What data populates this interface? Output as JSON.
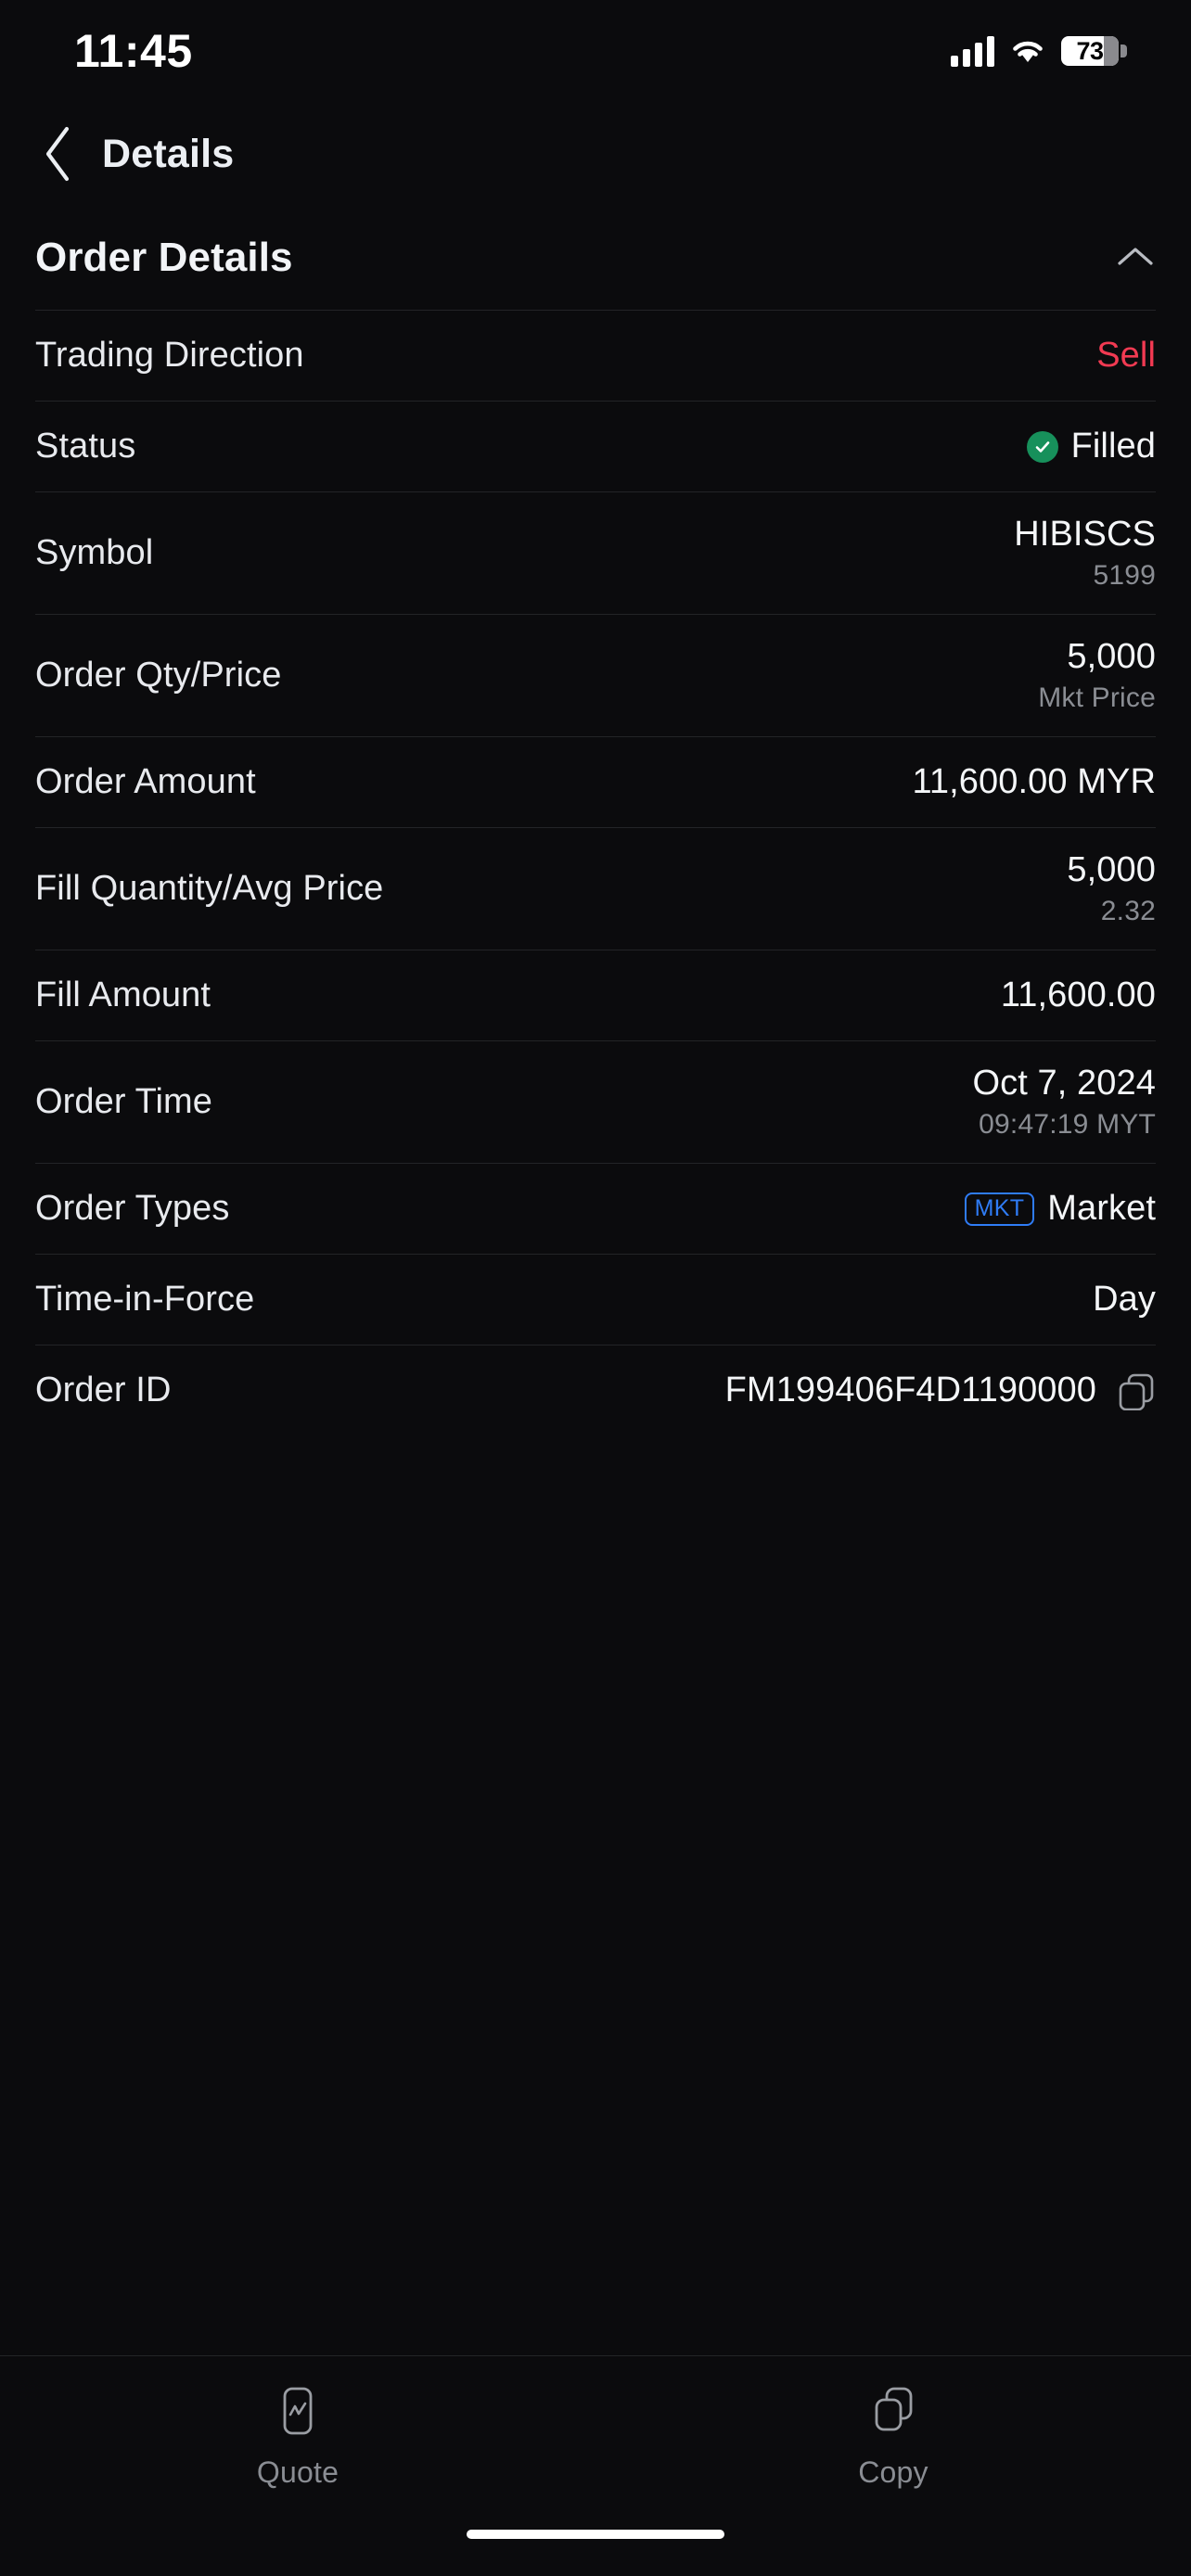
{
  "status_bar": {
    "time": "11:45",
    "battery_level": "73",
    "signal_icon": "cellular-signal-icon",
    "wifi_icon": "wifi-icon",
    "battery_icon": "battery-icon"
  },
  "nav": {
    "back_icon": "chevron-left-icon",
    "title": "Details"
  },
  "section": {
    "title": "Order Details",
    "collapse_icon": "chevron-up-icon"
  },
  "colors": {
    "sell_red": "#f23a52",
    "filled_green": "#17905b",
    "badge_blue": "#2f7cf6",
    "background": "#0b0b0d",
    "divider": "#232427",
    "muted_text": "#8a8d93"
  },
  "rows": [
    {
      "label": "Trading Direction",
      "value": "Sell",
      "sub": ""
    },
    {
      "label": "Status",
      "value": "Filled",
      "sub": ""
    },
    {
      "label": "Symbol",
      "value": "HIBISCS",
      "sub": "5199"
    },
    {
      "label": "Order Qty/Price",
      "value": "5,000",
      "sub": "Mkt Price"
    },
    {
      "label": "Order Amount",
      "value": "11,600.00 MYR",
      "sub": ""
    },
    {
      "label": "Fill Quantity/Avg Price",
      "value": "5,000",
      "sub": "2.32"
    },
    {
      "label": "Fill Amount",
      "value": "11,600.00",
      "sub": ""
    },
    {
      "label": "Order Time",
      "value": "Oct 7, 2024",
      "sub": "09:47:19 MYT"
    },
    {
      "label": "Order Types",
      "value": "Market",
      "sub": "",
      "badge": "MKT"
    },
    {
      "label": "Time-in-Force",
      "value": "Day",
      "sub": ""
    },
    {
      "label": "Order ID",
      "value": "FM199406F4D1190000",
      "sub": "",
      "copy_icon": "copy-icon"
    }
  ],
  "tabbar": {
    "items": [
      {
        "label": "Quote",
        "icon": "quote-chart-icon"
      },
      {
        "label": "Copy",
        "icon": "copy-icon"
      }
    ]
  }
}
